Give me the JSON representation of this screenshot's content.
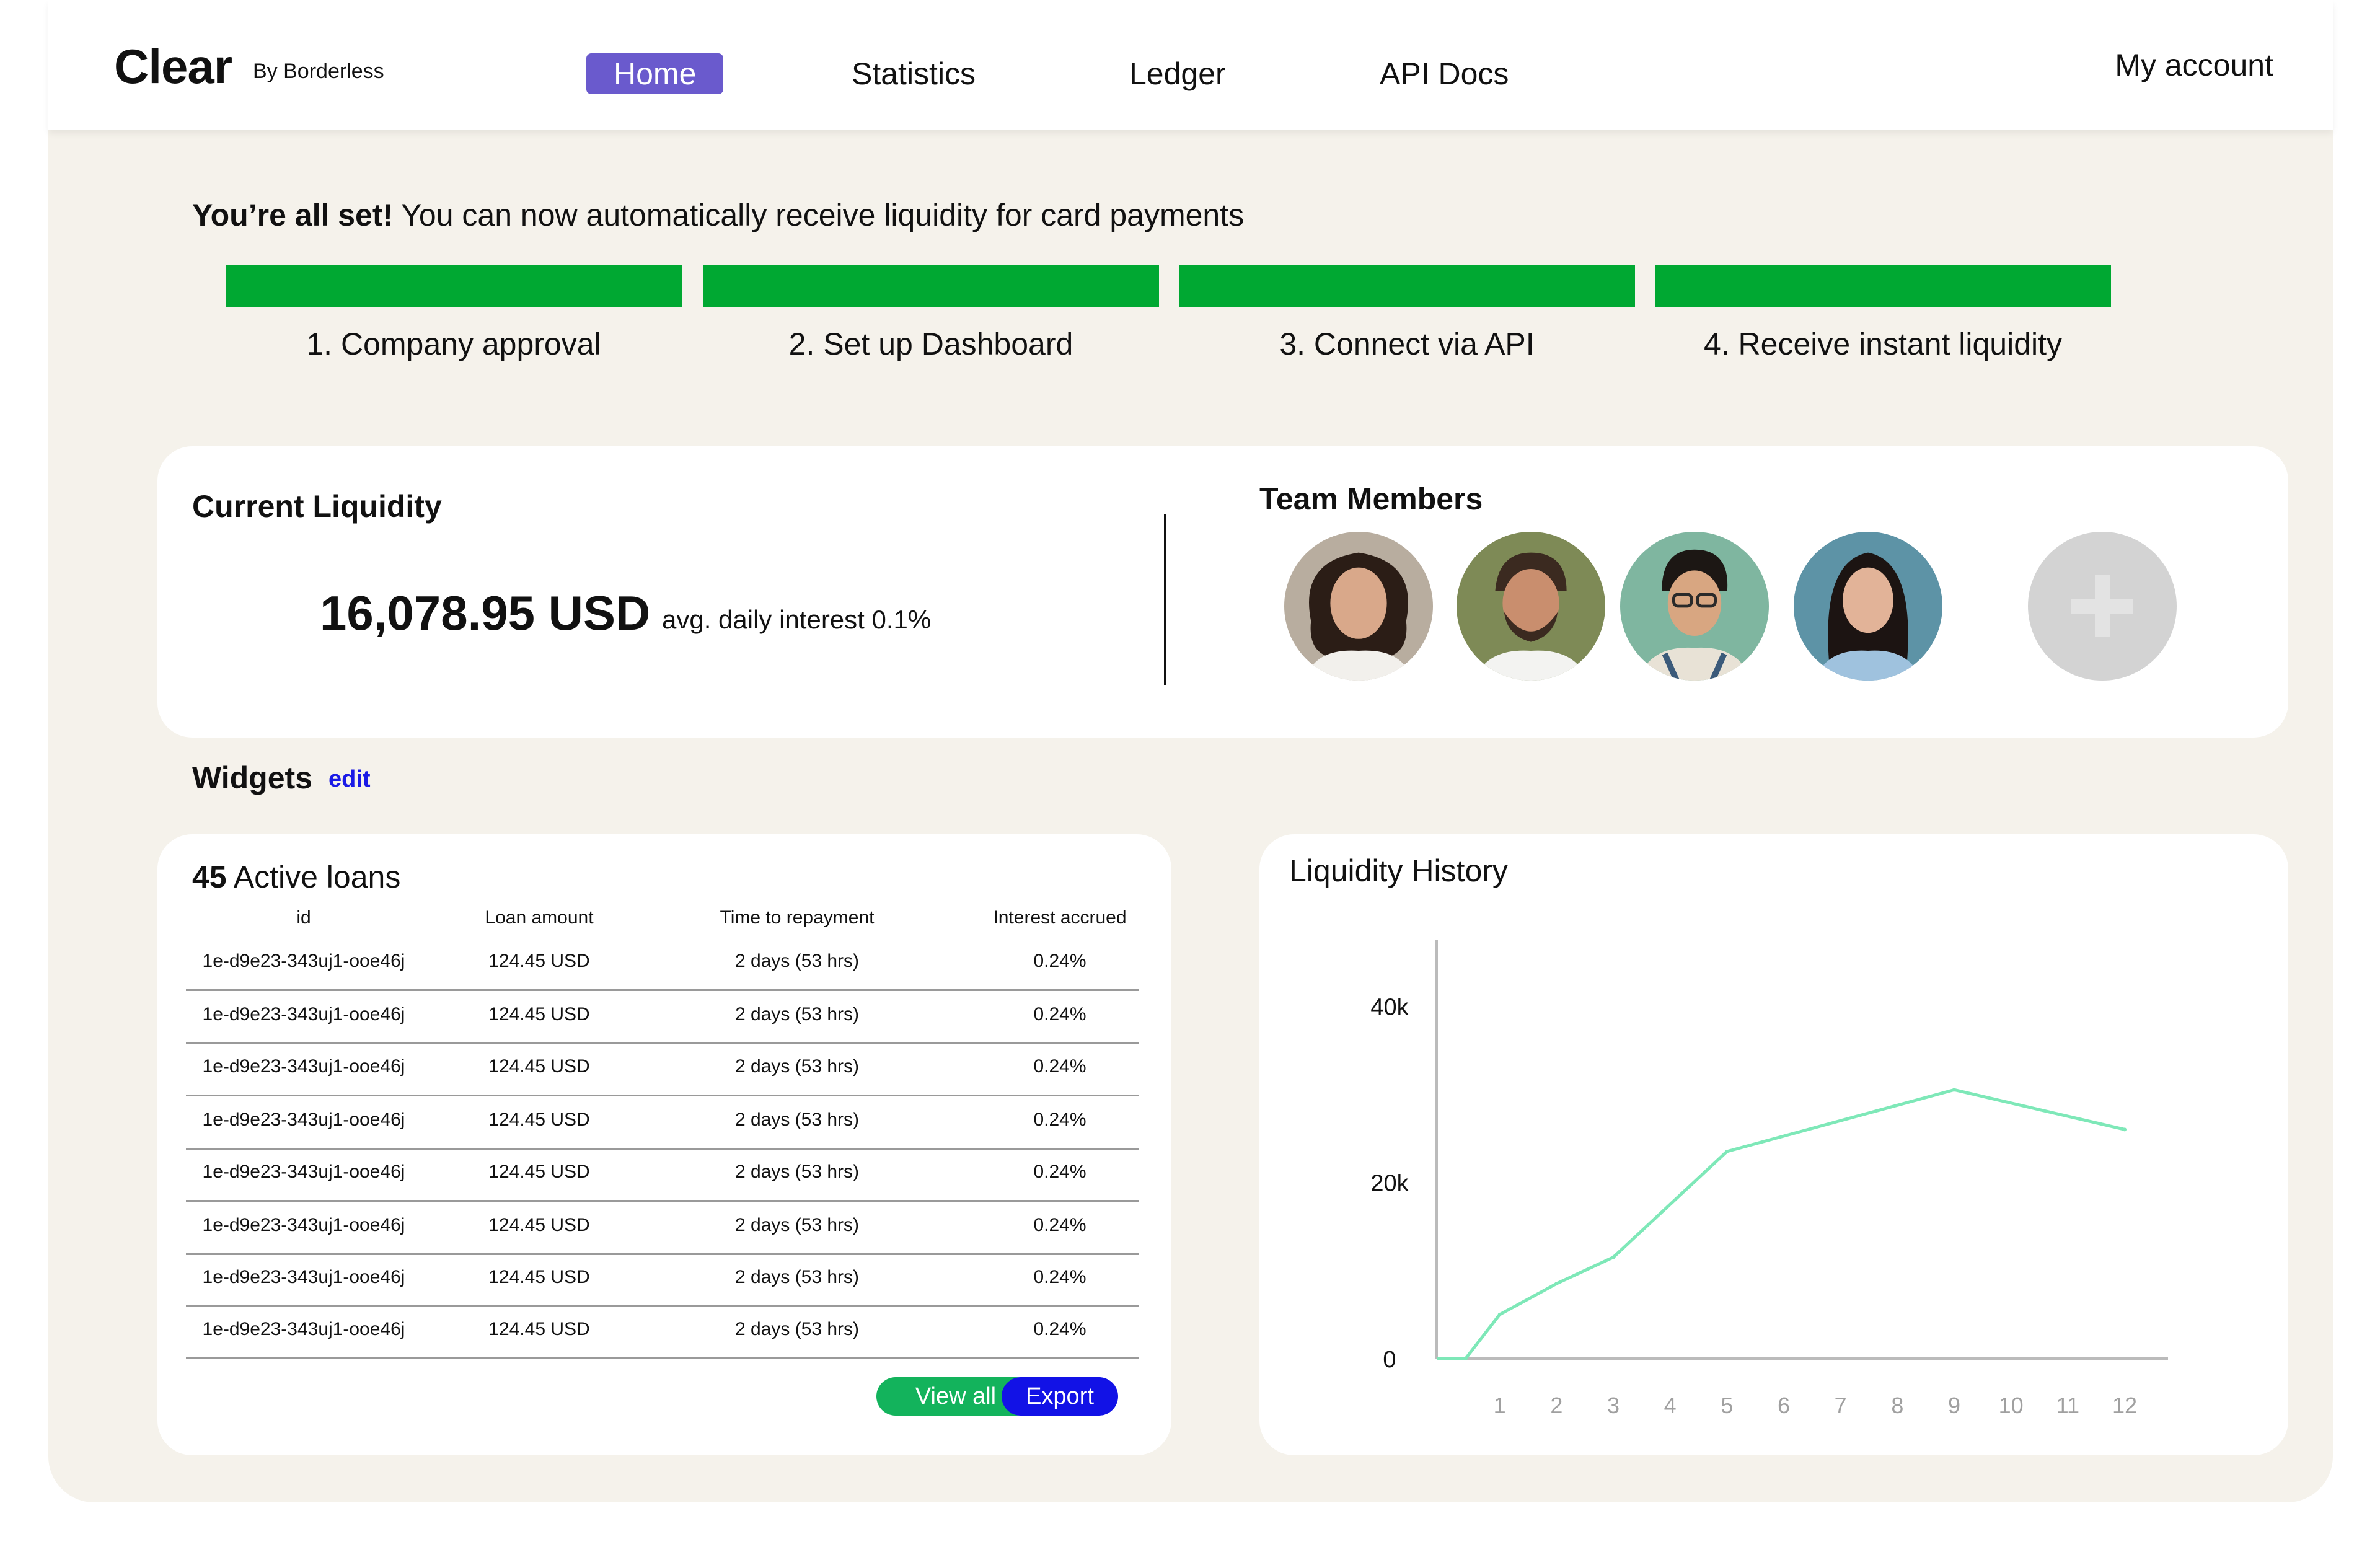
{
  "header": {
    "logo": "Clear",
    "byline": "By Borderless",
    "nav": [
      "Home",
      "Statistics",
      "Ledger",
      "API Docs"
    ],
    "account": "My account"
  },
  "setup": {
    "title_bold": "You’re all set!",
    "title_rest": " You can now automatically receive liquidity for card payments",
    "steps": [
      "1. Company approval",
      "2. Set up Dashboard",
      "3. Connect via API",
      "4. Receive instant liquidity"
    ],
    "step_color": "#00a832"
  },
  "liquidity": {
    "title": "Current Liquidity",
    "amount": "16,078.95 USD",
    "interest": "avg. daily interest 0.1%"
  },
  "team": {
    "title": "Team Members",
    "avatars": [
      "avatar-woman-curly",
      "avatar-man-beard",
      "avatar-man-glasses",
      "avatar-woman-long-hair"
    ],
    "add_icon": "plus-icon"
  },
  "widgets": {
    "title": "Widgets",
    "edit": "edit"
  },
  "loans": {
    "count": "45",
    "title": " Active loans",
    "columns": [
      "id",
      "Loan amount",
      "Time to repayment",
      "Interest accrued"
    ],
    "rows": [
      [
        "1e-d9e23-343uj1-ooe46j",
        "124.45 USD",
        "2 days (53 hrs)",
        "0.24%"
      ],
      [
        "1e-d9e23-343uj1-ooe46j",
        "124.45 USD",
        "2 days (53 hrs)",
        "0.24%"
      ],
      [
        "1e-d9e23-343uj1-ooe46j",
        "124.45 USD",
        "2 days (53 hrs)",
        "0.24%"
      ],
      [
        "1e-d9e23-343uj1-ooe46j",
        "124.45 USD",
        "2 days (53 hrs)",
        "0.24%"
      ],
      [
        "1e-d9e23-343uj1-ooe46j",
        "124.45 USD",
        "2 days (53 hrs)",
        "0.24%"
      ],
      [
        "1e-d9e23-343uj1-ooe46j",
        "124.45 USD",
        "2 days (53 hrs)",
        "0.24%"
      ],
      [
        "1e-d9e23-343uj1-ooe46j",
        "124.45 USD",
        "2 days (53 hrs)",
        "0.24%"
      ],
      [
        "1e-d9e23-343uj1-ooe46j",
        "124.45 USD",
        "2 days (53 hrs)",
        "0.24%"
      ]
    ],
    "view_all": "View all",
    "export": "Export"
  },
  "chart_data": {
    "type": "line",
    "title": "Liquidity History",
    "x": [
      1,
      2,
      3,
      4,
      5,
      6,
      7,
      8,
      9,
      10,
      11,
      12
    ],
    "x_points": [
      0.4,
      1,
      2,
      3,
      5,
      9,
      12
    ],
    "series": [
      {
        "values": [
          0,
          5000,
          8500,
          11500,
          23500,
          30500,
          26000
        ]
      }
    ],
    "y_ticks": [
      "0",
      "20k",
      "40k"
    ],
    "ylim": [
      0,
      46000
    ],
    "line_color": "#7ee8b8",
    "grid": false
  }
}
